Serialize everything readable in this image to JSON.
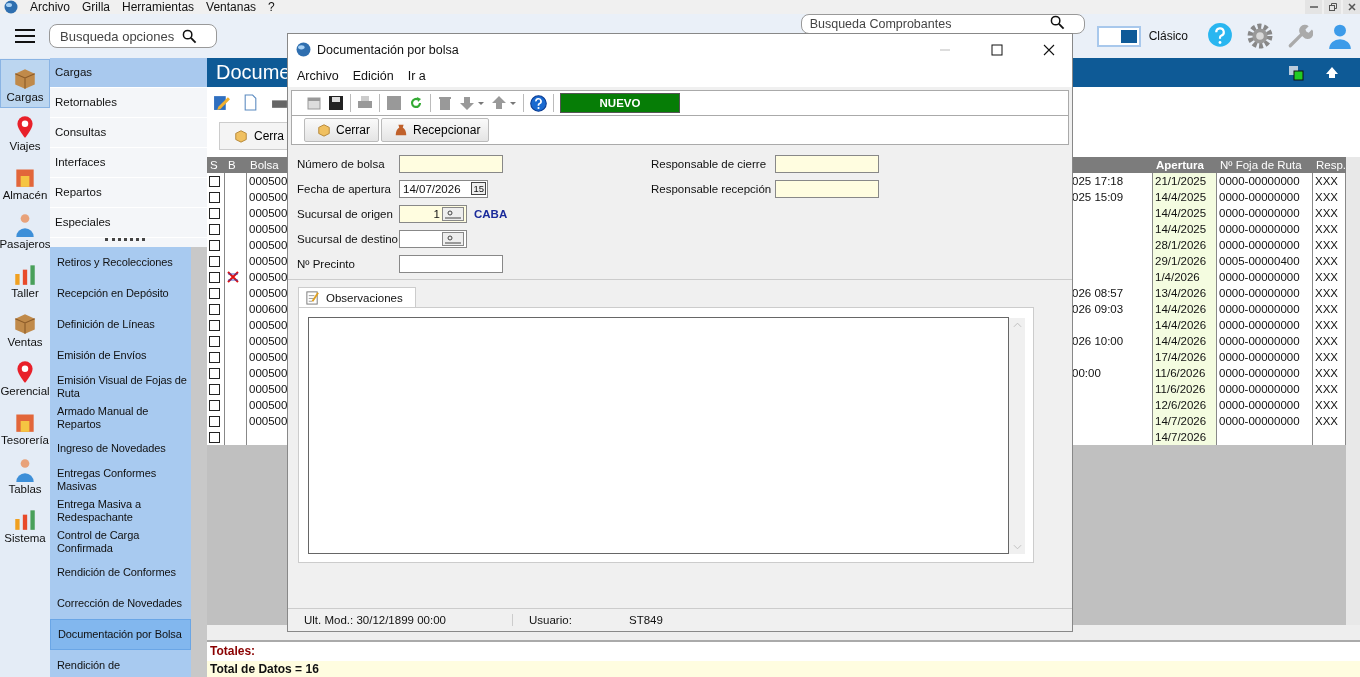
{
  "menu_bar": [
    "Archivo",
    "Grilla",
    "Herramientas",
    "Ventanas",
    "?"
  ],
  "search": {
    "placeholder": "Busqueda opciones"
  },
  "voucher_search": {
    "placeholder": "Busqueda Comprobantes"
  },
  "theme_toggle": {
    "label": "Clásico",
    "on": true
  },
  "modules": [
    {
      "label": "Cargas",
      "selected": true
    },
    {
      "label": "Viajes",
      "selected": false
    },
    {
      "label": "Almacén",
      "selected": false
    },
    {
      "label": "Pasajeros",
      "selected": false
    },
    {
      "label": "Taller",
      "selected": false
    },
    {
      "label": "Ventas",
      "selected": false
    },
    {
      "label": "Gerencial",
      "selected": false
    },
    {
      "label": "Tesorería",
      "selected": false
    },
    {
      "label": "Tablas",
      "selected": false
    },
    {
      "label": "Sistema",
      "selected": false
    }
  ],
  "sections": [
    {
      "label": "Cargas",
      "selected": true
    },
    {
      "label": "Retornables",
      "selected": false
    },
    {
      "label": "Consultas",
      "selected": false
    },
    {
      "label": "Interfaces",
      "selected": false
    },
    {
      "label": "Repartos",
      "selected": false
    },
    {
      "label": "Especiales",
      "selected": false
    }
  ],
  "submenu": [
    {
      "label": "Retiros y Recolecciones",
      "selected": false
    },
    {
      "label": "Recepción en Depósito",
      "selected": false
    },
    {
      "label": "Definición de Líneas",
      "selected": false
    },
    {
      "label": "Emisión de Envíos",
      "selected": false
    },
    {
      "label": "Emisión Visual de Fojas de Ruta",
      "selected": false
    },
    {
      "label": "Armado Manual de Repartos",
      "selected": false
    },
    {
      "label": "Ingreso de Novedades",
      "selected": false
    },
    {
      "label": "Entregas Conformes Masivas",
      "selected": false
    },
    {
      "label": "Entrega Masiva a Redespachante",
      "selected": false
    },
    {
      "label": "Control de Carga Confirmada",
      "selected": false
    },
    {
      "label": "Rendición de Conformes",
      "selected": false
    },
    {
      "label": "Corrección de Novedades",
      "selected": false
    },
    {
      "label": "Documentación por Bolsa",
      "selected": true
    },
    {
      "label": "Rendición de",
      "selected": false
    }
  ],
  "document": {
    "title": "Docume",
    "close_button": "Cerra"
  },
  "grid": {
    "columns": [
      "S",
      "B",
      "Bolsa",
      "Apertura",
      "Nº Foja de Ruta",
      "Resp."
    ],
    "rows": [
      {
        "checked": false,
        "marked": false,
        "bolsa": "000500",
        "column_4": "025 17:18",
        "apertura": "21/1/2025",
        "foja": "0000-00000000",
        "resp": "XXX"
      },
      {
        "checked": false,
        "marked": false,
        "bolsa": "000500",
        "column_4": "025 15:09",
        "apertura": "14/4/2025",
        "foja": "0000-00000000",
        "resp": "XXX"
      },
      {
        "checked": false,
        "marked": false,
        "bolsa": "000500",
        "apertura": "14/4/2025",
        "foja": "0000-00000000",
        "resp": "XXX"
      },
      {
        "checked": false,
        "marked": false,
        "bolsa": "000500",
        "apertura": "14/4/2025",
        "foja": "0000-00000000",
        "resp": "XXX"
      },
      {
        "checked": false,
        "marked": false,
        "bolsa": "000500",
        "apertura": "28/1/2026",
        "foja": "0000-00000000",
        "resp": "XXX"
      },
      {
        "checked": false,
        "marked": false,
        "bolsa": "000500",
        "apertura": "29/1/2026",
        "foja": "0005-00000400",
        "resp": "XXX"
      },
      {
        "checked": false,
        "marked": true,
        "bolsa": "000500",
        "apertura": "1/4/2026",
        "foja": "0000-00000000",
        "resp": "XXX"
      },
      {
        "checked": false,
        "marked": false,
        "bolsa": "000500",
        "column_4": "026 08:57",
        "apertura": "13/4/2026",
        "foja": "0000-00000000",
        "resp": "XXX"
      },
      {
        "checked": false,
        "marked": false,
        "bolsa": "000600",
        "column_4": "026 09:03",
        "apertura": "14/4/2026",
        "foja": "0000-00000000",
        "resp": "XXX"
      },
      {
        "checked": false,
        "marked": false,
        "bolsa": "000500",
        "apertura": "14/4/2026",
        "foja": "0000-00000000",
        "resp": "XXX"
      },
      {
        "checked": false,
        "marked": false,
        "bolsa": "000500",
        "column_4": "026 10:00",
        "apertura": "14/4/2026",
        "foja": "0000-00000000",
        "resp": "XXX"
      },
      {
        "checked": false,
        "marked": false,
        "bolsa": "000500",
        "apertura": "17/4/2026",
        "foja": "0000-00000000",
        "resp": "XXX"
      },
      {
        "checked": false,
        "marked": false,
        "bolsa": "000500",
        "column_4": "00:00",
        "apertura": "11/6/2026",
        "foja": "0000-00000000",
        "resp": "XXX"
      },
      {
        "checked": false,
        "marked": false,
        "bolsa": "000500",
        "apertura": "11/6/2026",
        "foja": "0000-00000000",
        "resp": "XXX"
      },
      {
        "checked": false,
        "marked": false,
        "bolsa": "000500",
        "apertura": "12/6/2026",
        "foja": "0000-00000000",
        "resp": "XXX"
      },
      {
        "checked": false,
        "marked": false,
        "bolsa": "000500",
        "apertura": "14/7/2026",
        "foja": "0000-00000000",
        "resp": "XXX"
      },
      {
        "checked": false,
        "marked": false,
        "apertura": "14/7/2026"
      }
    ]
  },
  "totals": {
    "title": "Totales:",
    "count": "Total de Datos = 16"
  },
  "dialog": {
    "title": "Documentación por bolsa",
    "menu": [
      "Archivo",
      "Edición",
      "Ir a"
    ],
    "status": "NUEVO",
    "buttons": [
      "Cerrar",
      "Recepcionar"
    ],
    "left_fields": [
      {
        "label": "Número de bolsa",
        "kind": "text",
        "required": true
      },
      {
        "label": "Fecha de apertura",
        "kind": "date",
        "value": "14/07/2026",
        "picker": "15",
        "required": false
      },
      {
        "label": "Sucursal de origen",
        "kind": "lookup",
        "value": "1",
        "description": "CABA",
        "required": true
      },
      {
        "label": "Sucursal de destino",
        "kind": "lookup",
        "required": false
      },
      {
        "label": "Nº Precinto",
        "kind": "text",
        "required": false
      }
    ],
    "right_fields": [
      {
        "label": "Responsable de cierre",
        "kind": "text",
        "required": true
      },
      {
        "label": "Responsable recepción",
        "kind": "text",
        "required": true
      }
    ],
    "tab": "Observaciones",
    "status_bar": [
      "Ult. Mod.: 30/12/1899 00:00",
      "Usuario:",
      "ST849"
    ]
  }
}
